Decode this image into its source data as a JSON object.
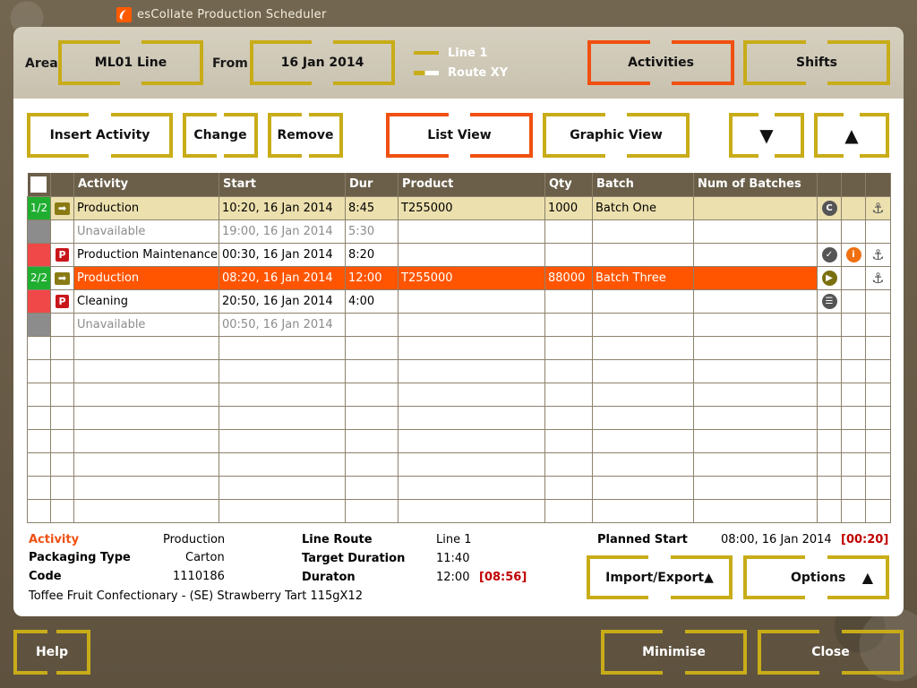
{
  "app": {
    "title": "esCollate Production Scheduler"
  },
  "header": {
    "area_label": "Area",
    "area_value": "ML01 Line",
    "from_label": "From",
    "from_value": "16 Jan 2014",
    "legend": [
      {
        "label": "Line 1"
      },
      {
        "label": "Route XY"
      }
    ],
    "activities_label": "Activities",
    "shifts_label": "Shifts"
  },
  "toolbar": {
    "insert_label": "Insert Activity",
    "change_label": "Change",
    "remove_label": "Remove",
    "list_view_label": "List View",
    "graphic_view_label": "Graphic View",
    "down_label": "▼",
    "up_label": "▲"
  },
  "table": {
    "columns": [
      "Activity",
      "Start",
      "Dur",
      "Product",
      "Qty",
      "Batch",
      "Num of Batches"
    ],
    "rows": [
      {
        "seq": "1/2",
        "activity": "Production",
        "start": "10:20, 16 Jan 2014",
        "dur": "8:45",
        "product": "T255000",
        "qty": "1000",
        "batch": "Batch One",
        "num": ""
      },
      {
        "seq": "",
        "activity": "Unavailable",
        "start": "19:00, 16 Jan 2014",
        "dur": "5:30",
        "product": "",
        "qty": "",
        "batch": "",
        "num": ""
      },
      {
        "seq": "",
        "activity": "Production Maintenance",
        "start": "00:30, 16 Jan 2014",
        "dur": "8:20",
        "product": "",
        "qty": "",
        "batch": "",
        "num": ""
      },
      {
        "seq": "2/2",
        "activity": "Production",
        "start": "08:20, 16 Jan 2014",
        "dur": "12:00",
        "product": "T255000",
        "qty": "88000",
        "batch": "Batch Three",
        "num": ""
      },
      {
        "seq": "",
        "activity": "Cleaning",
        "start": "20:50, 16 Jan 2014",
        "dur": "4:00",
        "product": "",
        "qty": "",
        "batch": "",
        "num": ""
      },
      {
        "seq": "",
        "activity": "Unavailable",
        "start": "00:50, 16 Jan 2014",
        "dur": "",
        "product": "",
        "qty": "",
        "batch": "",
        "num": ""
      }
    ],
    "icons": {
      "row0_status": "C",
      "row2_status": "✓",
      "row2_info": "i",
      "row3_status": "▶",
      "row4_status": "☰",
      "anchor": "⚓",
      "arrow": "➡",
      "p": "P"
    }
  },
  "details": {
    "activity_label": "Activity",
    "activity_value": "Production",
    "packaging_label": "Packaging Type",
    "packaging_value": "Carton",
    "code_label": "Code",
    "code_value": "1110186",
    "description": "Toffee Fruit Confectionary - (SE) Strawberry Tart 115gX12",
    "line_route_label": "Line Route",
    "line_route_value": "Line 1",
    "target_label": "Target Duration",
    "target_value": "11:40",
    "duration_label": "Duraton",
    "duration_value": "12:00",
    "duration_delta": "[08:56]",
    "planned_label": "Planned Start",
    "planned_value": "08:00, 16 Jan 2014",
    "planned_delta": "[00:20]",
    "import_label": "Import/Export▲",
    "options_label": "Options",
    "options_arrow": "▲"
  },
  "footer": {
    "help_label": "Help",
    "minimise_label": "Minimise",
    "close_label": "Close"
  }
}
